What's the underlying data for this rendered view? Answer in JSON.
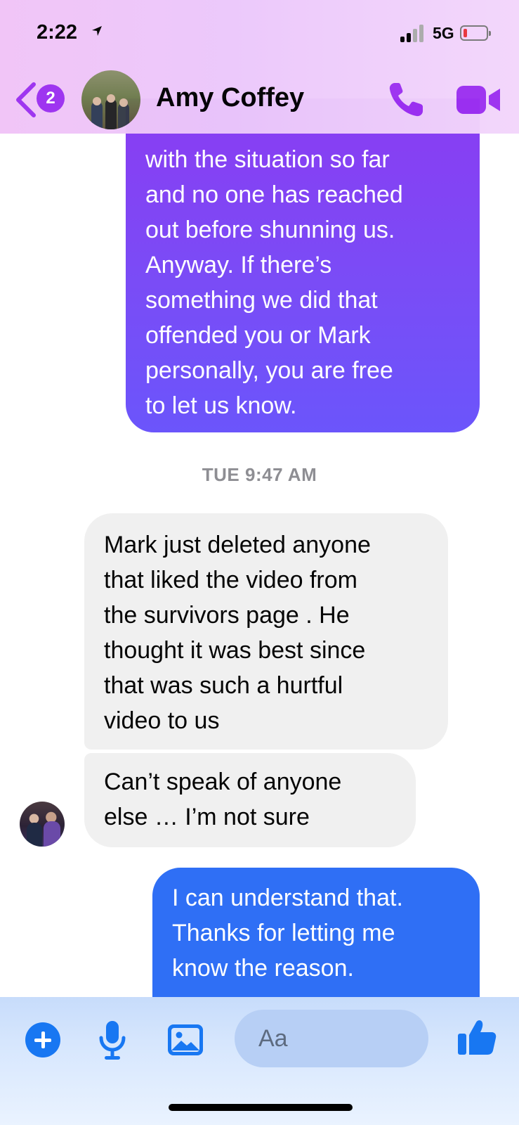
{
  "status_bar": {
    "time": "2:22",
    "network": "5G"
  },
  "header": {
    "unread_count": "2",
    "contact_name": "Amy Coffey"
  },
  "messages": {
    "outgoing_1": "with the situation so far\nand no one has reached\nout before shunning us.\nAnyway. If there’s\nsomething we did that\noffended you or Mark\npersonally, you are free\nto let us know.",
    "timestamp": "TUE 9:47 AM",
    "incoming_1": "Mark just deleted anyone\nthat liked the video from\nthe survivors page .    He\nthought it was best since\nthat was such a hurtful\nvideo to us",
    "incoming_2": "Can’t speak of anyone\nelse … I’m not sure",
    "outgoing_2": "I can understand that.\nThanks for letting me\nknow the reason."
  },
  "composer": {
    "placeholder": "Aa"
  },
  "colors": {
    "header_bg": "#ecc8fb",
    "accent": "#9b2ff0",
    "outgoing_gradient_top": "#8a3cf2",
    "outgoing_blue": "#2f6ff5",
    "incoming_bg": "#f0f0f0",
    "composer_blue": "#1877f2"
  },
  "icons": [
    "navigation-arrow-icon",
    "signal-icon",
    "battery-icon",
    "back-chevron-icon",
    "phone-icon",
    "video-camera-icon",
    "plus-icon",
    "microphone-icon",
    "photo-icon",
    "thumbs-up-icon"
  ]
}
